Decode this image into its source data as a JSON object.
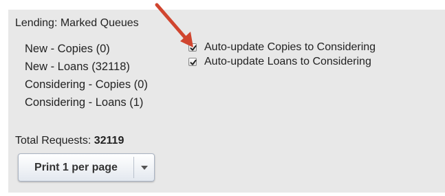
{
  "lending": {
    "title": "Lending: Marked Queues",
    "queues": [
      "New - Copies (0)",
      "New - Loans (32118)",
      "Considering - Copies (0)",
      "Considering - Loans (1)"
    ],
    "options": [
      {
        "label": "Auto-update Copies to Considering",
        "checked": true
      },
      {
        "label": "Auto-update Loans to Considering",
        "checked": true
      }
    ],
    "total_label": "Total Requests:",
    "total_value": "32119",
    "print_button_label": "Print 1 per page"
  },
  "colors": {
    "panel_bg": "#e8e8e8",
    "annotation_arrow": "#d0452f"
  }
}
